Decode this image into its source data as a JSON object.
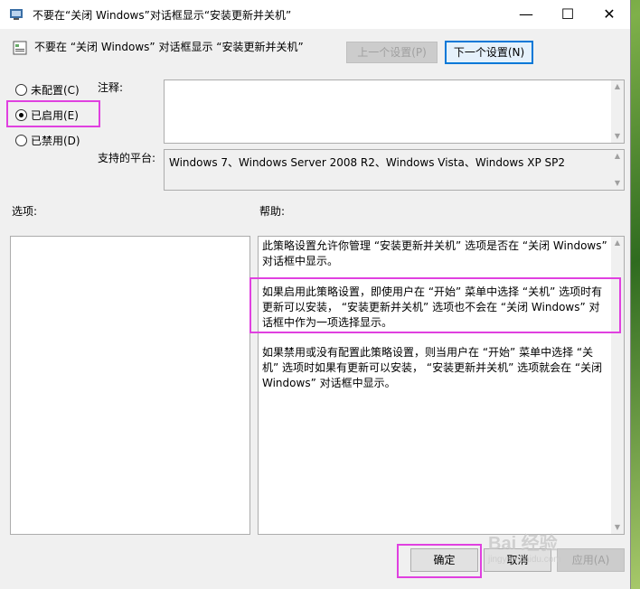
{
  "window": {
    "title": "不要在“关闭 Windows”对话框显示“安装更新并关机”",
    "minimize": "—",
    "maximize": "☐",
    "close": "✕"
  },
  "header": {
    "policy_name": "不要在 “关闭 Windows” 对话框显示 “安装更新并关机”",
    "prev_button": "上一个设置(P)",
    "next_button": "下一个设置(N)"
  },
  "state": {
    "options": [
      {
        "label": "未配置(C)",
        "selected": false
      },
      {
        "label": "已启用(E)",
        "selected": true
      },
      {
        "label": "已禁用(D)",
        "selected": false
      }
    ]
  },
  "comment": {
    "label": "注释:",
    "value": ""
  },
  "platform": {
    "label": "支持的平台:",
    "value": "Windows 7、Windows Server 2008 R2、Windows Vista、Windows XP SP2"
  },
  "options_label": "选项:",
  "help": {
    "label": "帮助:",
    "paragraphs": [
      "此策略设置允许你管理 “安装更新并关机” 选项是否在 “关闭 Windows” 对话框中显示。",
      "如果启用此策略设置，即使用户在 “开始” 菜单中选择 “关机” 选项时有更新可以安装， “安装更新并关机” 选项也不会在 “关闭 Windows” 对话框中作为一项选择显示。",
      "如果禁用或没有配置此策略设置，则当用户在 “开始” 菜单中选择 “关机” 选项时如果有更新可以安装， “安装更新并关机” 选项就会在 “关闭 Windows” 对话框中显示。"
    ]
  },
  "footer": {
    "ok": "确定",
    "cancel": "取消",
    "apply": "应用(A)"
  },
  "watermark": {
    "brand": "Bai 经验",
    "url": "jingyan.baidu.com"
  },
  "colors": {
    "highlight": "#e040e0",
    "focus": "#0078d7"
  }
}
